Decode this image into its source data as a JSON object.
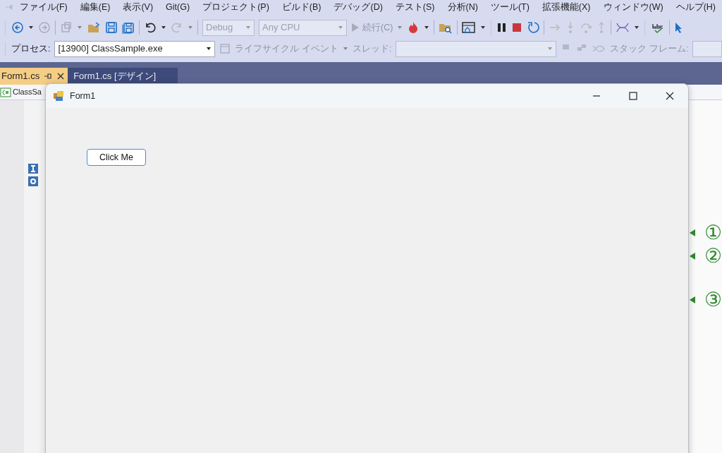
{
  "menu": [
    "ファイル(F)",
    "編集(E)",
    "表示(V)",
    "Git(G)",
    "プロジェクト(P)",
    "ビルド(B)",
    "デバッグ(D)",
    "テスト(S)",
    "分析(N)",
    "ツール(T)",
    "拡張機能(X)",
    "ウィンドウ(W)",
    "ヘルプ(H)"
  ],
  "toolbar": {
    "configuration": "Debug",
    "platform": "Any CPU",
    "continue": "続行(C)"
  },
  "debug_location": {
    "process_label": "プロセス:",
    "process": "[13900] ClassSample.exe",
    "lifecycle": "ライフサイクル イベント",
    "thread_label": "スレッド:",
    "stack_label": "スタック フレーム:"
  },
  "tabs": [
    {
      "label": "Form1.cs",
      "selected": true
    },
    {
      "label": "Form1.cs [デザイン]",
      "selected": false
    }
  ],
  "navigation": {
    "project": "ClassSa"
  },
  "form_window": {
    "title": "Form1",
    "button": "Click Me"
  },
  "margin_marks": [
    "①",
    "②",
    "③"
  ]
}
